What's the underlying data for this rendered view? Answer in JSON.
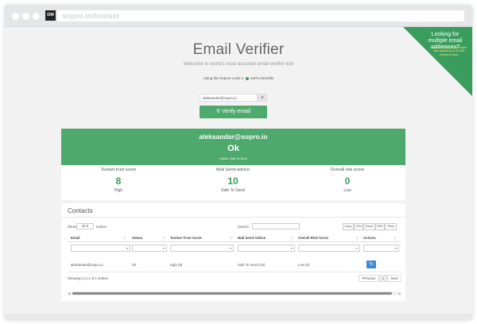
{
  "browser": {
    "favicon_text": "DM",
    "url": "sopro.io/toolset"
  },
  "header": {
    "title": "Email Verifier",
    "subtitle": "Welcome to world's most accurate email verifier tool",
    "cost_prefix": "Using this feature costs 1",
    "cost_suffix": "SoPro benefits"
  },
  "form": {
    "email_value": "aleksandar@sopro.io",
    "clear_icon": "x-circle-icon",
    "verify_label": "Verify email",
    "verify_icon": "search-icon"
  },
  "promo": {
    "title": "Looking for multiple email addresses?",
    "text": "Switch to Bulk Email Finder and upload up to 10,000 names at once."
  },
  "result": {
    "email": "aleksandar@sopro.io",
    "status": "Ok",
    "advice": "Advice: Safe To Send",
    "color": "#4ea96c"
  },
  "scores": [
    {
      "label": "Toolset trust score",
      "value": "8",
      "text": "High"
    },
    {
      "label": "Mail Send advice",
      "value": "10",
      "text": "Safe To Send"
    },
    {
      "label": "Overall risk score",
      "value": "0",
      "text": "Low"
    }
  ],
  "contacts": {
    "title": "Contacts",
    "show_label": "Show",
    "page_size": "20",
    "entries_label": "entries",
    "search_label": "Search:",
    "export_buttons": [
      "Copy",
      "CSV",
      "Excel",
      "PDF",
      "Print"
    ],
    "columns": [
      "Email",
      "Status",
      "Toolset Trust Score",
      "Mail Send Advice",
      "Overall Risk Score",
      "Actions"
    ],
    "rows": [
      [
        "aleksandar@sopro.io",
        "Ok",
        "High (8)",
        "Safe To Send (10)",
        "Low (0)",
        ""
      ]
    ],
    "action_icon": "refresh-icon",
    "showing": "Showing 1 to 1 of 1 entries",
    "pager": {
      "previous": "Previous",
      "current": "1",
      "next": "Next"
    }
  }
}
